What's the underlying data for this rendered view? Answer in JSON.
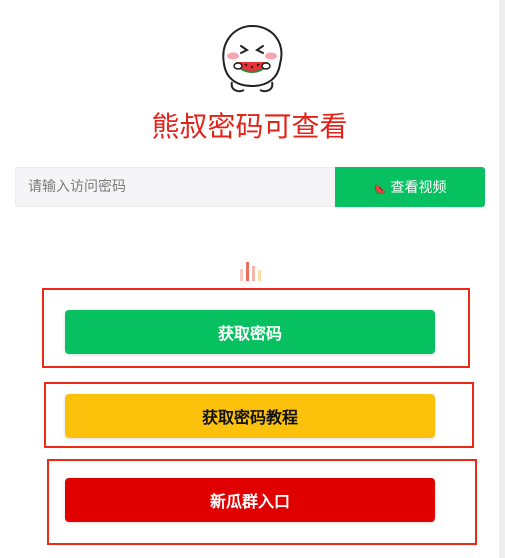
{
  "colors": {
    "title_red": "#e2231a",
    "green": "#07c160",
    "yellow": "#fcc20b",
    "red": "#e00000",
    "annotation_red": "#ee2a16"
  },
  "header": {
    "mascot_icon": "watermelon-bun-mascot",
    "title": "熊叔密码可查看"
  },
  "search": {
    "placeholder": "请输入访问密码",
    "value": "",
    "button_icon": "watermelon-icon",
    "button_label": "查看视频"
  },
  "loader_icon": "bar-loader-icon",
  "actions": [
    {
      "label": "获取密码"
    },
    {
      "label": "获取密码教程"
    },
    {
      "label": "新瓜群入口"
    }
  ]
}
